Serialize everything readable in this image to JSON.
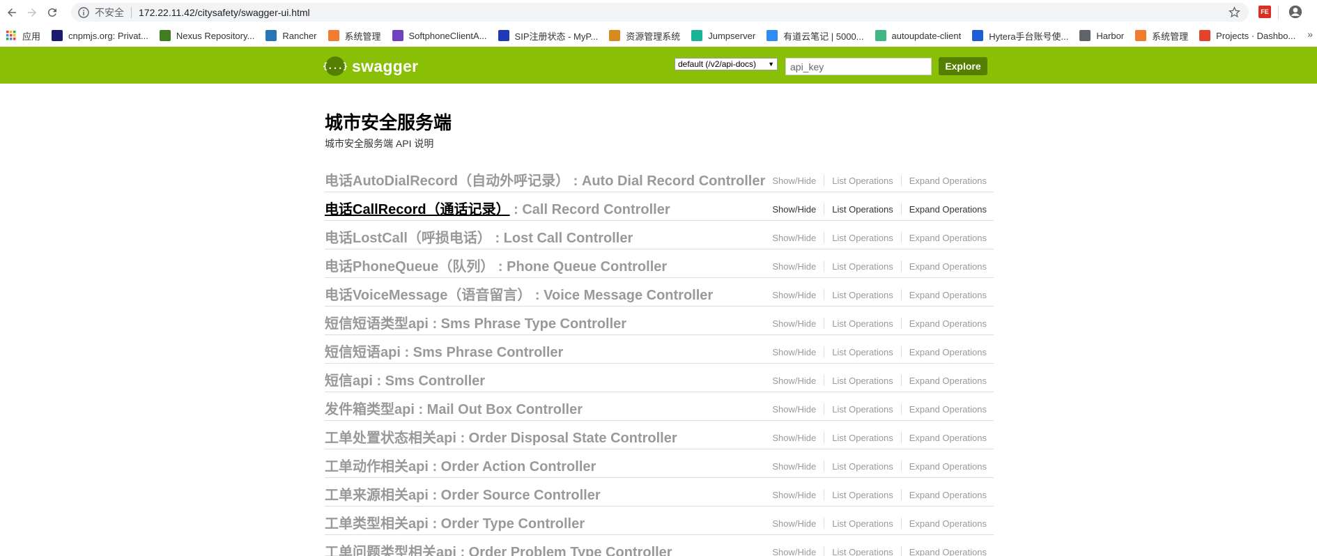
{
  "browser": {
    "insecure_label": "不安全",
    "url": "172.22.11.42/citysafety/swagger-ui.html",
    "extension_label": "FE",
    "bookmarks": [
      {
        "label": "应用",
        "icon": "apps-grid-icon",
        "color": "#e0483e"
      },
      {
        "label": "cnpmjs.org: Privat...",
        "icon": "npm-icon",
        "color": "#1a1a6e"
      },
      {
        "label": "Nexus Repository...",
        "icon": "nexus-icon",
        "color": "#3f7d1e"
      },
      {
        "label": "Rancher",
        "icon": "rancher-icon",
        "color": "#2775b6"
      },
      {
        "label": "系统管理",
        "icon": "cube-icon",
        "color": "#f07c2e"
      },
      {
        "label": "SoftphoneClientA...",
        "icon": "softphone-icon",
        "color": "#6f42c1"
      },
      {
        "label": "SIP注册状态 - MyP...",
        "icon": "sip-icon",
        "color": "#1f3ab8"
      },
      {
        "label": "资源管理系统",
        "icon": "resource-icon",
        "color": "#d88a1f"
      },
      {
        "label": "Jumpserver",
        "icon": "jumpserver-icon",
        "color": "#1ab394"
      },
      {
        "label": "有道云笔记 | 5000...",
        "icon": "youdao-icon",
        "color": "#2f8cf0"
      },
      {
        "label": "autoupdate-client",
        "icon": "vue-icon",
        "color": "#41b883"
      },
      {
        "label": "Hytera手台账号使...",
        "icon": "hytera-icon",
        "color": "#1e5bd6"
      },
      {
        "label": "Harbor",
        "icon": "harbor-icon",
        "color": "#60646b"
      },
      {
        "label": "系统管理",
        "icon": "cube-icon",
        "color": "#f07c2e"
      },
      {
        "label": "Projects · Dashbo...",
        "icon": "gitlab-icon",
        "color": "#e24329"
      }
    ],
    "more_label": "»"
  },
  "header": {
    "logo_mark": "{...}",
    "logo_text": "swagger",
    "spec_selected": "default (/v2/api-docs)",
    "api_key_placeholder": "api_key",
    "explore_label": "Explore",
    "bg_color": "#89bf04",
    "accent_color": "#547f00"
  },
  "info": {
    "title": "城市安全服务端",
    "description": "城市安全服务端 API 说明"
  },
  "operations_labels": {
    "show_hide": "Show/Hide",
    "list": "List Operations",
    "expand": "Expand Operations"
  },
  "resources": [
    {
      "name": "电话AutoDialRecord（自动外呼记录）",
      "controller": " : Auto Dial Record Controller",
      "active": false
    },
    {
      "name": "电话CallRecord（通话记录）",
      "controller": " : Call Record Controller",
      "active": true
    },
    {
      "name": "电话LostCall（呼损电话）",
      "controller": " : Lost Call Controller",
      "active": false
    },
    {
      "name": "电话PhoneQueue（队列）",
      "controller": " : Phone Queue Controller",
      "active": false
    },
    {
      "name": "电话VoiceMessage（语音留言）",
      "controller": " : Voice Message Controller",
      "active": false
    },
    {
      "name": "短信短语类型api",
      "controller": " : Sms Phrase Type Controller",
      "active": false
    },
    {
      "name": "短信短语api",
      "controller": " : Sms Phrase Controller",
      "active": false
    },
    {
      "name": "短信api",
      "controller": " : Sms Controller",
      "active": false
    },
    {
      "name": "发件箱类型api",
      "controller": " : Mail Out Box Controller",
      "active": false
    },
    {
      "name": "工单处置状态相关api",
      "controller": " : Order Disposal State Controller",
      "active": false
    },
    {
      "name": "工单动作相关api",
      "controller": " : Order Action Controller",
      "active": false
    },
    {
      "name": "工单来源相关api",
      "controller": " : Order Source Controller",
      "active": false
    },
    {
      "name": "工单类型相关api",
      "controller": " : Order Type Controller",
      "active": false
    },
    {
      "name": "工单问题类型相关api",
      "controller": " : Order Problem Type Controller",
      "active": false
    }
  ]
}
